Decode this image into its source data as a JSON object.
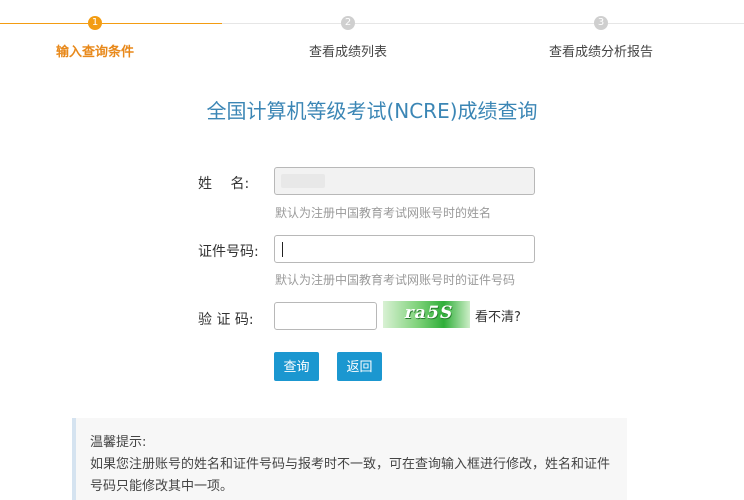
{
  "steps": [
    {
      "number": "1",
      "label": "输入查询条件",
      "active": true
    },
    {
      "number": "2",
      "label": "查看成绩列表",
      "active": false
    },
    {
      "number": "3",
      "label": "查看成绩分析报告",
      "active": false
    }
  ],
  "page_title": "全国计算机等级考试(NCRE)成绩查询",
  "form": {
    "name_label": "姓　 名:",
    "name_value": "",
    "name_hint": "默认为注册中国教育考试网账号时的姓名",
    "id_label": "证件号码:",
    "id_value": "",
    "id_hint": "默认为注册中国教育考试网账号时的证件号码",
    "captcha_label": "验 证 码:",
    "captcha_value": "",
    "captcha_image_text": "ra5S",
    "captcha_refresh": "看不清?"
  },
  "buttons": {
    "query": "查询",
    "back": "返回"
  },
  "tips": {
    "title": "温馨提示:",
    "body": "如果您注册账号的姓名和证件号码与报考时不一致，可在查询输入框进行修改，姓名和证件号码只能修改其中一项。"
  },
  "colors": {
    "active_step": "#f39c12",
    "title": "#3b86b5",
    "button": "#1b97d0",
    "hint": "#9a9a9a"
  }
}
